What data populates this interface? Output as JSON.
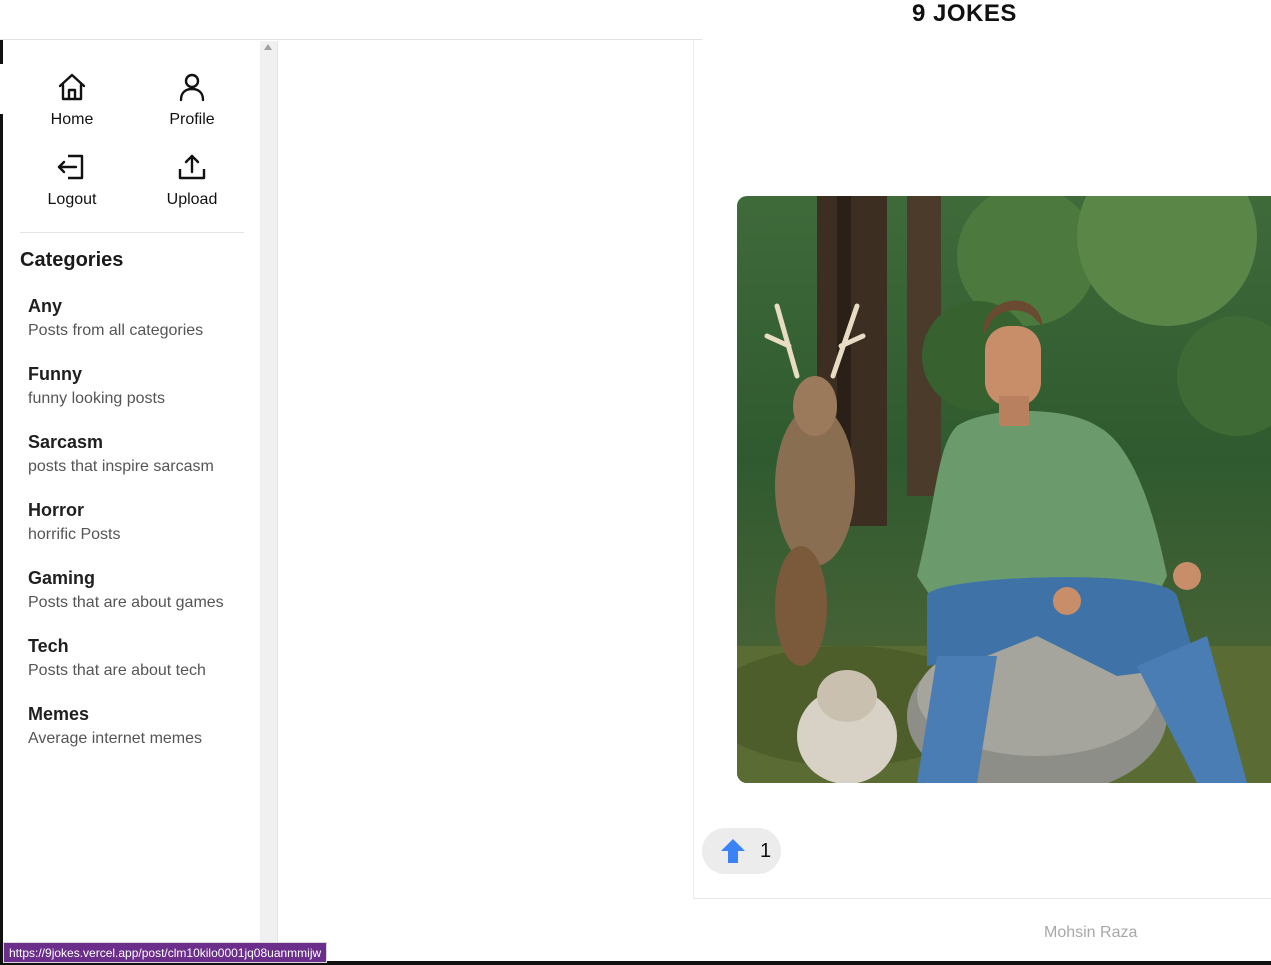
{
  "site": {
    "title": "9 JOKES"
  },
  "nav": [
    {
      "label": "Home",
      "icon": "home-icon"
    },
    {
      "label": "Profile",
      "icon": "user-icon"
    },
    {
      "label": "Logout",
      "icon": "logout-icon"
    },
    {
      "label": "Upload",
      "icon": "upload-icon"
    }
  ],
  "categories": {
    "heading": "Categories",
    "items": [
      {
        "name": "Any",
        "description": "Posts from all categories"
      },
      {
        "name": "Funny",
        "description": "funny looking posts"
      },
      {
        "name": "Sarcasm",
        "description": "posts that inspire sarcasm"
      },
      {
        "name": "Horror",
        "description": "horrific Posts"
      },
      {
        "name": "Gaming",
        "description": "Posts that are about games"
      },
      {
        "name": "Tech",
        "description": "Posts that are about tech"
      },
      {
        "name": "Memes",
        "description": "Average internet memes"
      }
    ]
  },
  "post": {
    "image": "photo of a man in a green shirt sitting on a rock with a deer, marmot and coyote in a forest",
    "upvotes": "1",
    "upvote_icon": "arrow-up-icon",
    "author": "Mohsin Raza"
  },
  "status_bar": {
    "url": "https://9jokes.vercel.app/post/clm10kilo0001jq08uanmmijw"
  },
  "colors": {
    "upvote_arrow": "#3b82f6",
    "status_bg": "#6b2e8a",
    "author_text": "#a8a8a8"
  }
}
